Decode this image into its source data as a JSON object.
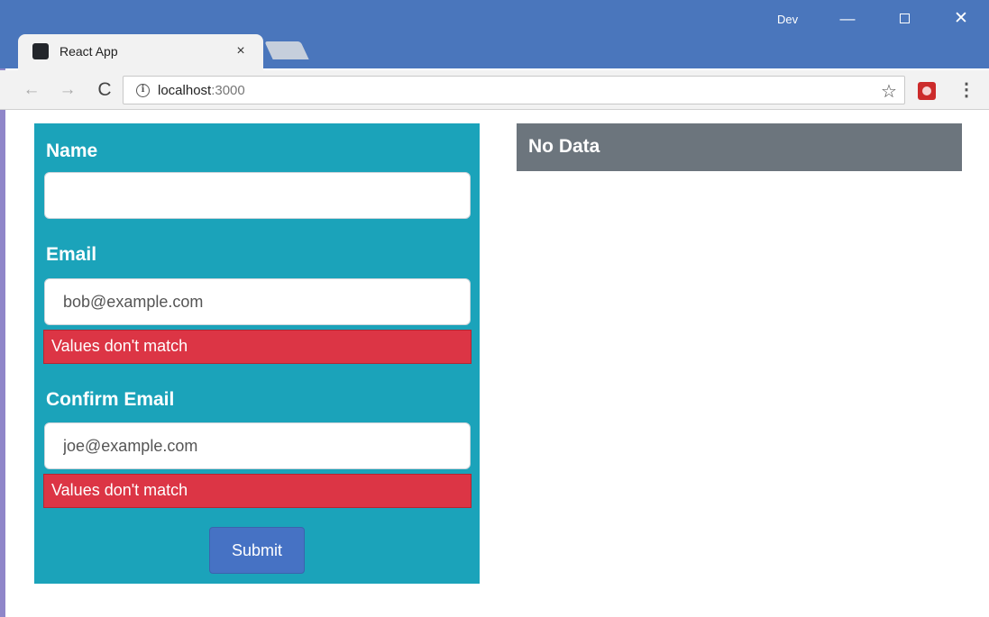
{
  "browser": {
    "tab_title": "React App",
    "tab_close": "×",
    "profile": "Dev",
    "window_buttons": {
      "minimize": "—",
      "close": "✕"
    },
    "url_host": "localhost",
    "url_port": ":3000",
    "nav": {
      "back": "←",
      "forward": "→",
      "reload": "C"
    },
    "icons": {
      "info": "i",
      "bookmark": "☆",
      "menu": "⋮"
    }
  },
  "form": {
    "name_label": "Name",
    "name_value": "",
    "email_label": "Email",
    "email_value": "bob@example.com",
    "email_error": "Values don't match",
    "confirm_label": "Confirm Email",
    "confirm_value": "joe@example.com",
    "confirm_error": "Values don't match",
    "submit_label": "Submit"
  },
  "summary": {
    "no_data": "No Data"
  },
  "colors": {
    "titlebar": "#4a76bc",
    "form_panel": "#1ba3ba",
    "error": "#dc3545",
    "submit": "#4672c4",
    "nodata": "#6c757d"
  }
}
